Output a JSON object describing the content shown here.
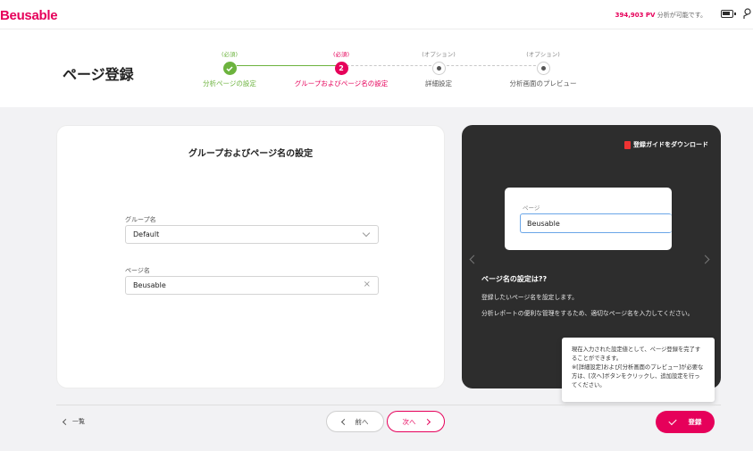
{
  "topbar": {
    "logo": "Beusable",
    "pv_count": "394,903 PV",
    "pv_suffix": " 分析が可能です。"
  },
  "header": {
    "title": "ページ登録",
    "steps": [
      {
        "tag": "(必須)",
        "label": "分析ページの設定",
        "status": "done",
        "number": ""
      },
      {
        "tag": "(必須)",
        "label": "グループおよびページ名の設定",
        "status": "active",
        "number": "2"
      },
      {
        "tag": "(オプション)",
        "label": "詳細設定",
        "status": "pending",
        "number": ""
      },
      {
        "tag": "(オプション)",
        "label": "分析画面のプレビュー",
        "status": "pending",
        "number": ""
      }
    ]
  },
  "form": {
    "title": "グループおよびページ名の設定",
    "group_label": "グループ名",
    "group_value": "Default",
    "page_label": "ページ名",
    "page_value": "Beusable"
  },
  "guide": {
    "download": "登録ガイドをダウンロード",
    "preview_label": "ページ",
    "preview_value": "Beusable",
    "heading": "ページ名の設定は??",
    "line1": "登録したいページ名を設定します。",
    "line2": "分析レポートの便利な管理をするため、適切なページ名を入力してください。"
  },
  "tooltip": {
    "text1": "現在入力された設定値として、ページ登録を完了することができます。",
    "text2": "※[詳細設定]および[分析画面のプレビュー]が必要な方は、[次へ]ボタンをクリックし、追加設定を行ってください。"
  },
  "footer": {
    "back_list": "一覧",
    "prev": "前へ",
    "next": "次へ",
    "register": "登録"
  },
  "colors": {
    "brand": "#e6005a",
    "done": "#6cb33e",
    "guide_bg": "#2d2d2d"
  }
}
